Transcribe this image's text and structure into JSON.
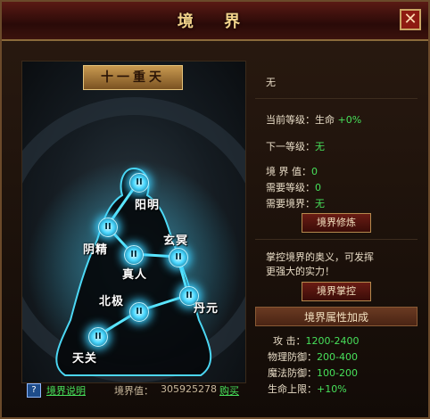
{
  "window": {
    "title": "境 界",
    "close_glyph": "✕"
  },
  "realm_panel": {
    "banner": "十一重天",
    "nodes": [
      {
        "id": "yangming",
        "label": "阳明",
        "badge": "II"
      },
      {
        "id": "yinjing",
        "label": "阴精",
        "badge": "II"
      },
      {
        "id": "xuanming",
        "label": "玄冥",
        "badge": "II"
      },
      {
        "id": "zhenren",
        "label": "真人",
        "badge": "II"
      },
      {
        "id": "danyuan",
        "label": "丹元",
        "badge": "II"
      },
      {
        "id": "beiji",
        "label": "北极",
        "badge": "II"
      },
      {
        "id": "tianguan",
        "label": "天关",
        "badge": "II"
      }
    ]
  },
  "info": {
    "current_realm": "无",
    "current_level_label": "当前等级：",
    "current_level_value": "生命",
    "current_level_bonus": "+0%",
    "next_level_label": "下一等级：",
    "next_level_value": "无",
    "realm_value_label": "境 界 值：",
    "realm_value": "0",
    "req_level_label": "需要等级：",
    "req_level_value": "0",
    "req_realm_label": "需要境界：",
    "req_realm_value": "无",
    "train_button": "境界修炼",
    "master_desc_line1": "掌控境界的奥义，可发挥",
    "master_desc_line2": "更强大的实力！",
    "master_button": "境界掌控",
    "attr_header": "境界属性加成",
    "attrs": [
      {
        "label": "攻    击：",
        "value": "1200-2400"
      },
      {
        "label": "物理防御：",
        "value": "200-400"
      },
      {
        "label": "魔法防御：",
        "value": "100-200"
      },
      {
        "label": "生命上限：",
        "value": "+10%"
      }
    ]
  },
  "footer": {
    "help_glyph": "?",
    "explain_link": "境界说明",
    "coin_label": "境界值：",
    "coin_value": "305925278",
    "buy_link": "购买"
  }
}
